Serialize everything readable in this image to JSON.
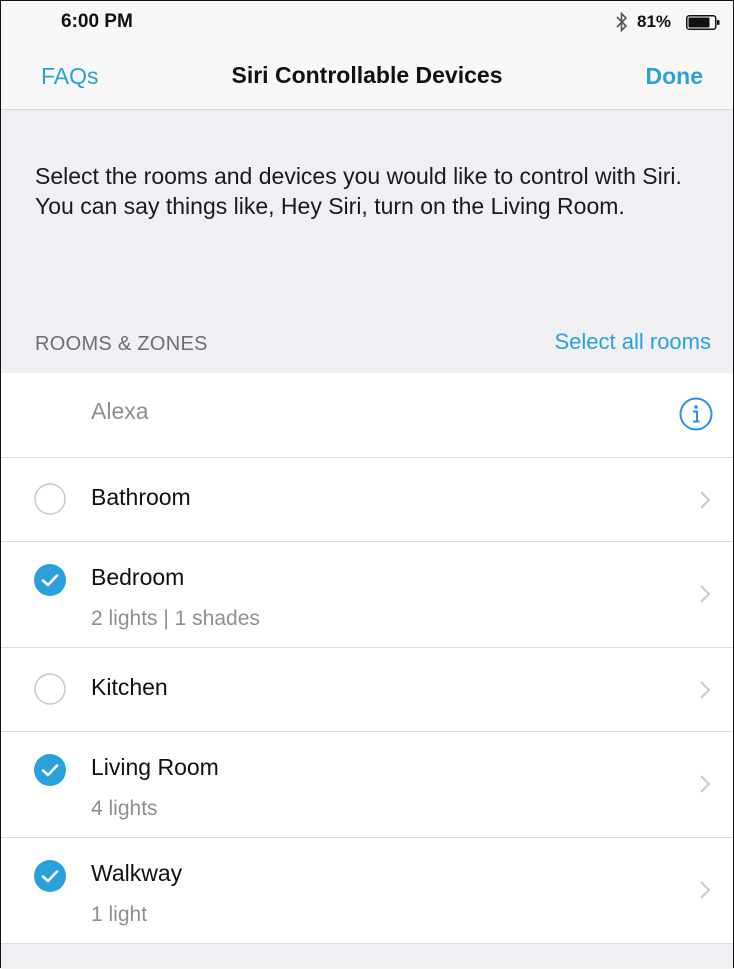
{
  "status_bar": {
    "time": "6:00 PM",
    "battery_percent": "81%",
    "bluetooth_icon": "bluetooth-icon",
    "battery_icon": "battery-icon"
  },
  "nav": {
    "left_label": "FAQs",
    "title": "Siri Controllable Devices",
    "right_label": "Done"
  },
  "intro_text": "Select the rooms and devices you would like to control with Siri. You can say things like, Hey Siri, turn on the Living Room.",
  "section": {
    "header": "ROOMS & ZONES",
    "select_all_label": "Select all rooms"
  },
  "alexa_row": {
    "label": "Alexa",
    "icon": "info-icon"
  },
  "rooms": [
    {
      "name": "Bathroom",
      "detail": "",
      "selected": false
    },
    {
      "name": "Bedroom",
      "detail": "2 lights | 1 shades",
      "selected": true
    },
    {
      "name": "Kitchen",
      "detail": "",
      "selected": false
    },
    {
      "name": "Living Room",
      "detail": "4 lights",
      "selected": true
    },
    {
      "name": "Walkway",
      "detail": "1 light",
      "selected": true
    }
  ],
  "colors": {
    "accent": "#2aa1da",
    "background": "#efeff4",
    "separator": "#dcdcdc"
  }
}
